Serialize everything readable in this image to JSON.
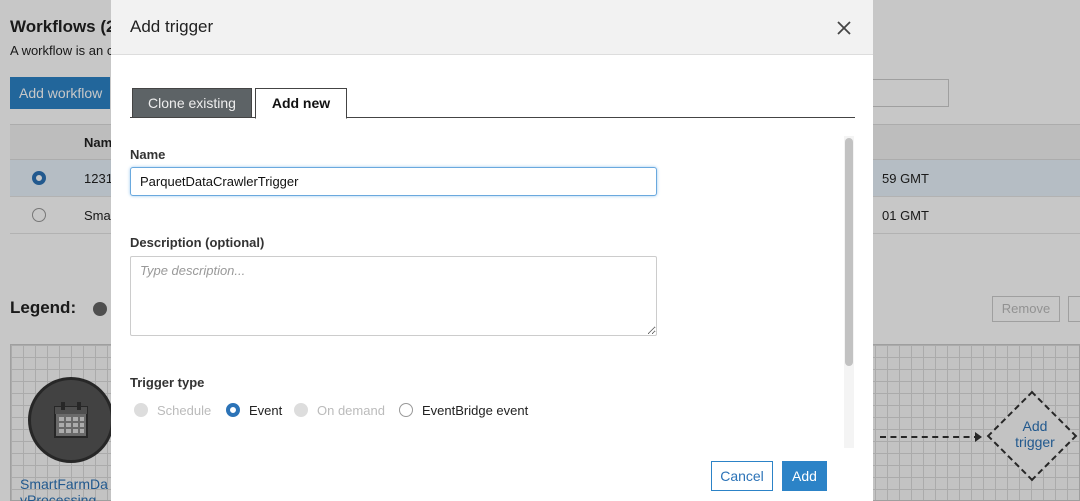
{
  "background": {
    "title": "Workflows (2",
    "description": "A workflow is an c",
    "add_workflow_label": "Add workflow",
    "table": {
      "header_name": "Nam",
      "rows": [
        {
          "name": "1231",
          "date": "59 GMT",
          "selected": true
        },
        {
          "name": "Sma",
          "date": "01 GMT",
          "selected": false
        }
      ]
    },
    "legend_label": "Legend:",
    "remove_label": "Remove",
    "node_label": "SmartFarmDa yProcessing",
    "add_trigger_node_label": "Add trigger"
  },
  "modal": {
    "title": "Add trigger",
    "tabs": [
      {
        "label": "Clone existing",
        "active": false
      },
      {
        "label": "Add new",
        "active": true
      }
    ],
    "name": {
      "label": "Name",
      "value": "ParquetDataCrawlerTrigger"
    },
    "description": {
      "label": "Description (optional)",
      "placeholder": "Type description..."
    },
    "trigger_type": {
      "label": "Trigger type",
      "options": [
        {
          "label": "Schedule",
          "disabled": true,
          "checked": false
        },
        {
          "label": "Event",
          "disabled": false,
          "checked": true
        },
        {
          "label": "On demand",
          "disabled": true,
          "checked": false
        },
        {
          "label": "EventBridge event",
          "disabled": false,
          "checked": false
        }
      ]
    },
    "buttons": {
      "cancel": "Cancel",
      "add": "Add"
    }
  },
  "colors": {
    "primary": "#2c83c7",
    "link": "#2c73b7",
    "tab_inactive_bg": "#5d6366"
  }
}
